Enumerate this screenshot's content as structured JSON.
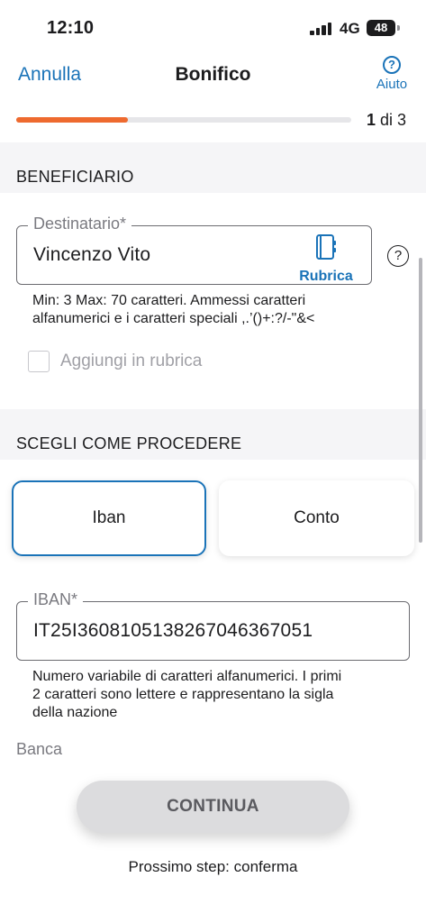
{
  "status_bar": {
    "time": "12:10",
    "network": "4G",
    "battery": "48"
  },
  "nav": {
    "cancel_label": "Annulla",
    "title": "Bonifico",
    "help_label": "Aiuto",
    "help_icon": "?"
  },
  "progress": {
    "current": "1",
    "of_text": " di 3",
    "fraction": 0.333
  },
  "beneficiario": {
    "section_title": "BENEFICIARIO",
    "recipient_label": "Destinatario*",
    "recipient_value": "Vincenzo Vito",
    "rubrica_label": "Rubrica",
    "help_icon": "?",
    "hint_line1": "Min: 3 Max: 70 caratteri. Ammessi caratteri",
    "hint_line2": "alfanumerici e i caratteri speciali ,.’()+:?/-\"&<",
    "add_to_contacts_label": "Aggiungi in rubrica",
    "add_to_contacts_checked": false
  },
  "procedure": {
    "section_title": "SCEGLI COME PROCEDERE",
    "options": [
      {
        "label": "Iban",
        "selected": true
      },
      {
        "label": "Conto",
        "selected": false
      }
    ]
  },
  "iban": {
    "label": "IBAN*",
    "value": "IT25I3608105138267046367051",
    "hint_line1": "Numero variabile di caratteri alfanumerici. I primi",
    "hint_line2": "2 caratteri sono lettere e rappresentano la sigla",
    "hint_line3": "della nazione"
  },
  "bank": {
    "label": "Banca"
  },
  "footer": {
    "continue_label": "CONTINUA",
    "next_step": "Prossimo step: conferma"
  },
  "colors": {
    "accent": "#1a73b8",
    "progress": "#ee6a2f",
    "section_bg": "#f5f5f7"
  }
}
